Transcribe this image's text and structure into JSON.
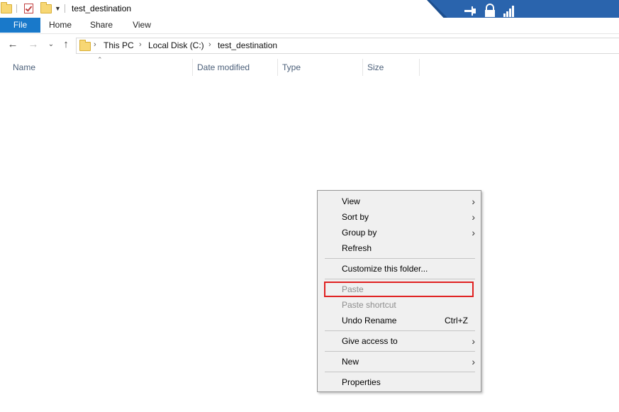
{
  "window": {
    "title": "test_destination"
  },
  "ribbon": {
    "tabs": [
      {
        "label": "File"
      },
      {
        "label": "Home"
      },
      {
        "label": "Share"
      },
      {
        "label": "View"
      }
    ]
  },
  "address": {
    "crumbs": [
      "This PC",
      "Local Disk (C:)",
      "test_destination"
    ]
  },
  "columns": [
    "Name",
    "Date modified",
    "Type",
    "Size"
  ],
  "context_menu": {
    "items": [
      {
        "label": "View",
        "submenu": true
      },
      {
        "label": "Sort by",
        "submenu": true
      },
      {
        "label": "Group by",
        "submenu": true
      },
      {
        "label": "Refresh"
      },
      {
        "label": "Customize this folder..."
      },
      {
        "label": "Paste",
        "disabled": true,
        "highlighted": true
      },
      {
        "label": "Paste shortcut",
        "disabled": true
      },
      {
        "label": "Undo Rename",
        "shortcut": "Ctrl+Z"
      },
      {
        "label": "Give access to",
        "submenu": true
      },
      {
        "label": "New",
        "submenu": true
      },
      {
        "label": "Properties"
      }
    ]
  },
  "colors": {
    "file_tab": "#1979ca",
    "vm_bar": "#1c4f8f",
    "highlight": "#e02020"
  },
  "icons": {
    "submenu_arrow": "chevron-right-icon"
  }
}
